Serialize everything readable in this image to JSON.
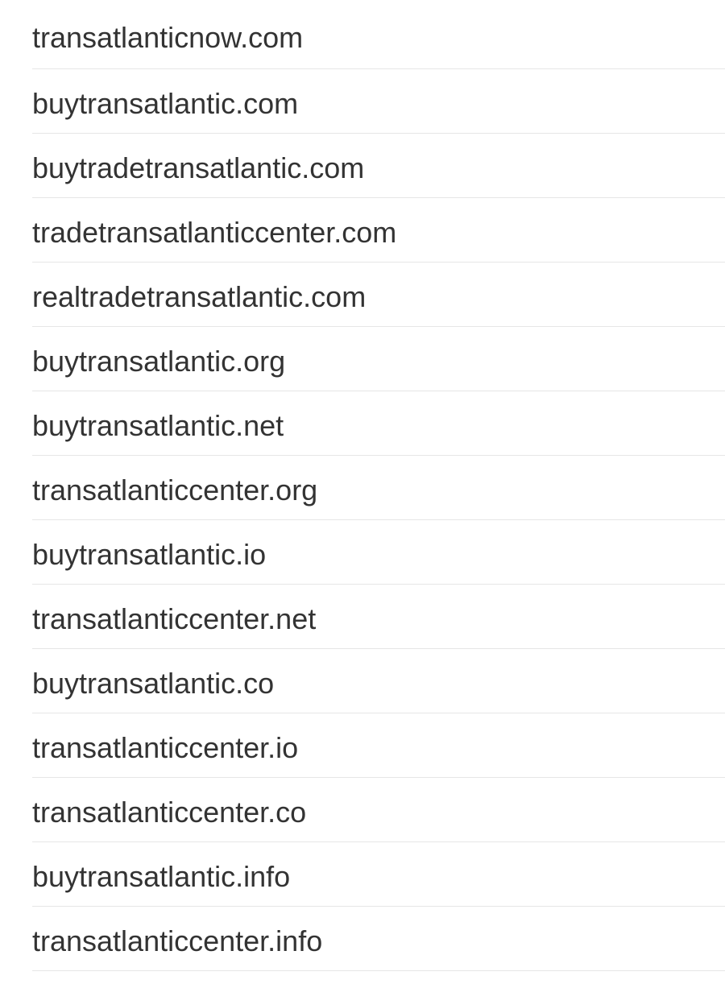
{
  "domains": [
    "transatlanticnow.com",
    "buytransatlantic.com",
    "buytradetransatlantic.com",
    "tradetransatlanticcenter.com",
    "realtradetransatlantic.com",
    "buytransatlantic.org",
    "buytransatlantic.net",
    "transatlanticcenter.org",
    "buytransatlantic.io",
    "transatlanticcenter.net",
    "buytransatlantic.co",
    "transatlanticcenter.io",
    "transatlanticcenter.co",
    "buytransatlantic.info",
    "transatlanticcenter.info"
  ],
  "colors": {
    "text": "#333333",
    "divider": "#e6e6e6",
    "background": "#ffffff"
  }
}
